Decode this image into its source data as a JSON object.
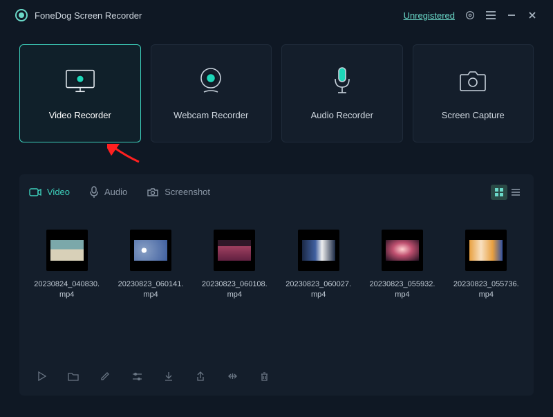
{
  "app": {
    "title": "FoneDog Screen Recorder",
    "registration_label": "Unregistered"
  },
  "features": [
    {
      "label": "Video Recorder",
      "icon": "monitor-record",
      "active": true
    },
    {
      "label": "Webcam Recorder",
      "icon": "webcam",
      "active": false
    },
    {
      "label": "Audio Recorder",
      "icon": "microphone",
      "active": false
    },
    {
      "label": "Screen Capture",
      "icon": "camera",
      "active": false
    }
  ],
  "library": {
    "tabs": [
      {
        "label": "Video",
        "icon": "video",
        "active": true
      },
      {
        "label": "Audio",
        "icon": "mic",
        "active": false
      },
      {
        "label": "Screenshot",
        "icon": "camera",
        "active": false
      }
    ],
    "items": [
      {
        "name": "20230824_040830.mp4"
      },
      {
        "name": "20230823_060141.mp4"
      },
      {
        "name": "20230823_060108.mp4"
      },
      {
        "name": "20230823_060027.mp4"
      },
      {
        "name": "20230823_055932.mp4"
      },
      {
        "name": "20230823_055736.mp4"
      }
    ],
    "tools": [
      "play",
      "folder",
      "edit",
      "settings",
      "download",
      "export",
      "cut",
      "delete"
    ]
  }
}
